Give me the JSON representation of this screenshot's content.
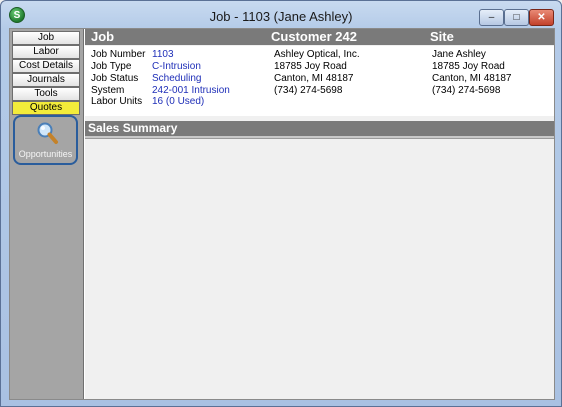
{
  "window": {
    "title": "Job - 1103 (Jane Ashley)",
    "app_icon_letter": "S",
    "controls": {
      "minimize": "–",
      "maximize": "□",
      "close": "✕"
    }
  },
  "sidebar": {
    "tabs": [
      {
        "label": "Job",
        "active": false
      },
      {
        "label": "Labor",
        "active": false
      },
      {
        "label": "Cost Details",
        "active": false
      },
      {
        "label": "Journals",
        "active": false
      },
      {
        "label": "Tools",
        "active": false
      },
      {
        "label": "Quotes",
        "active": true
      }
    ],
    "opportunities": {
      "label": "Opportunities",
      "icon": "magnifier-icon"
    }
  },
  "job": {
    "header": "Job",
    "fields": [
      {
        "label": "Job Number",
        "value": "1103"
      },
      {
        "label": "Job Type",
        "value": "C-Intrusion"
      },
      {
        "label": "Job Status",
        "value": "Scheduling"
      },
      {
        "label": "System",
        "value": "242-001 Intrusion"
      },
      {
        "label": "Labor Units",
        "value": "16 (0 Used)"
      }
    ]
  },
  "customer": {
    "header": "Customer 242",
    "lines": [
      "Ashley Optical, Inc.",
      "18785 Joy Road",
      "Canton, MI  48187",
      "(734) 274-5698"
    ]
  },
  "site": {
    "header": "Site",
    "lines": [
      "Jane Ashley",
      "18785 Joy Road",
      "Canton, MI  48187",
      "(734) 274-5698"
    ]
  },
  "sales_summary": {
    "title": "Sales Summary"
  },
  "colors": {
    "active_tab": "#f3ec3a",
    "link_value": "#1f2fb8",
    "band": "#7a7a7a",
    "sidebar": "#a5a5a5"
  }
}
